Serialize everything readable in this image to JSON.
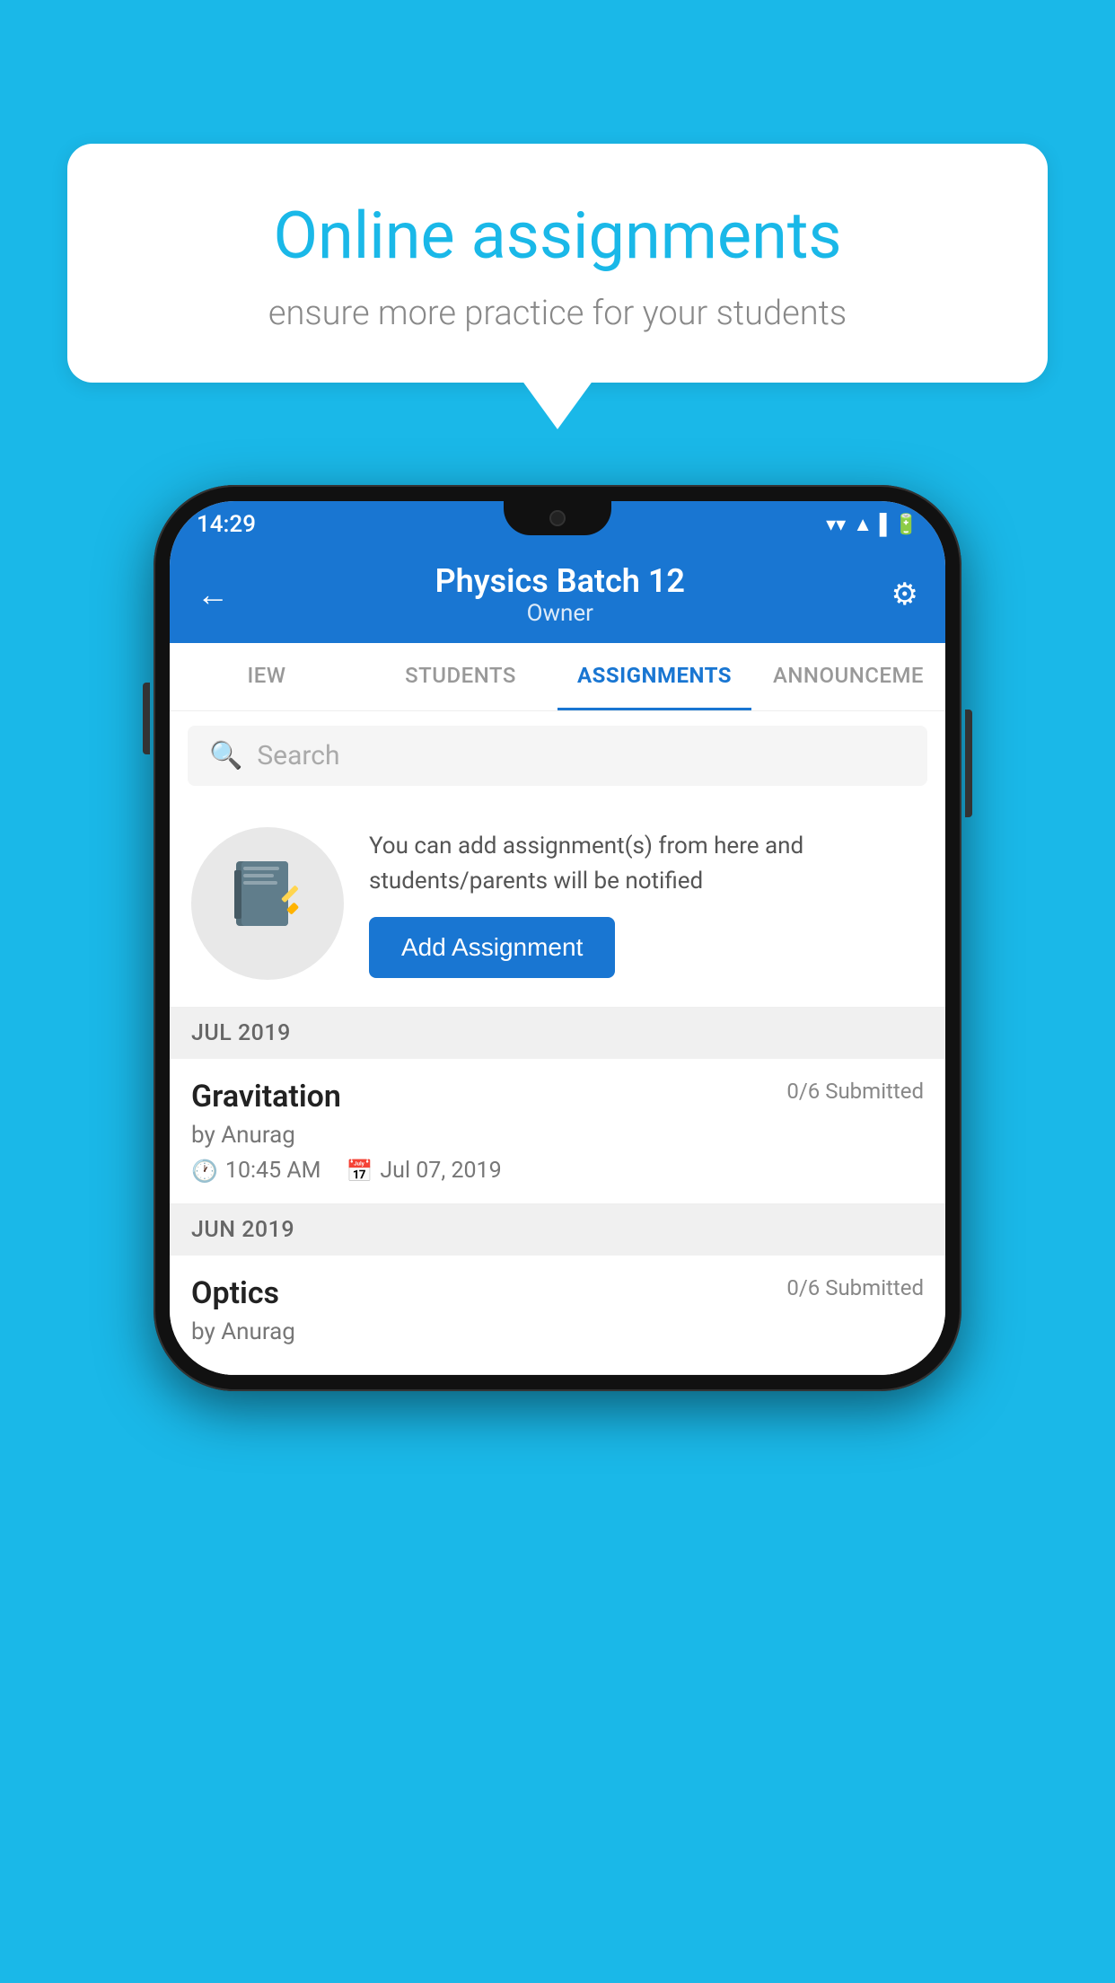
{
  "background_color": "#1ab8e8",
  "speech_bubble": {
    "title": "Online assignments",
    "subtitle": "ensure more practice for your students"
  },
  "status_bar": {
    "time": "14:29",
    "wifi_icon": "▼",
    "signal_icon": "▲",
    "battery_icon": "▐"
  },
  "header": {
    "title": "Physics Batch 12",
    "subtitle": "Owner",
    "back_label": "←",
    "settings_label": "⚙"
  },
  "tabs": [
    {
      "label": "IEW",
      "active": false
    },
    {
      "label": "STUDENTS",
      "active": false
    },
    {
      "label": "ASSIGNMENTS",
      "active": true
    },
    {
      "label": "ANNOUNCEME",
      "active": false
    }
  ],
  "search": {
    "placeholder": "Search"
  },
  "promo": {
    "text": "You can add assignment(s) from here and students/parents will be notified",
    "button_label": "Add Assignment"
  },
  "sections": [
    {
      "month": "JUL 2019",
      "assignments": [
        {
          "name": "Gravitation",
          "submitted": "0/6 Submitted",
          "author": "by Anurag",
          "time": "10:45 AM",
          "date": "Jul 07, 2019"
        }
      ]
    },
    {
      "month": "JUN 2019",
      "assignments": [
        {
          "name": "Optics",
          "submitted": "0/6 Submitted",
          "author": "by Anurag",
          "time": "",
          "date": ""
        }
      ]
    }
  ]
}
